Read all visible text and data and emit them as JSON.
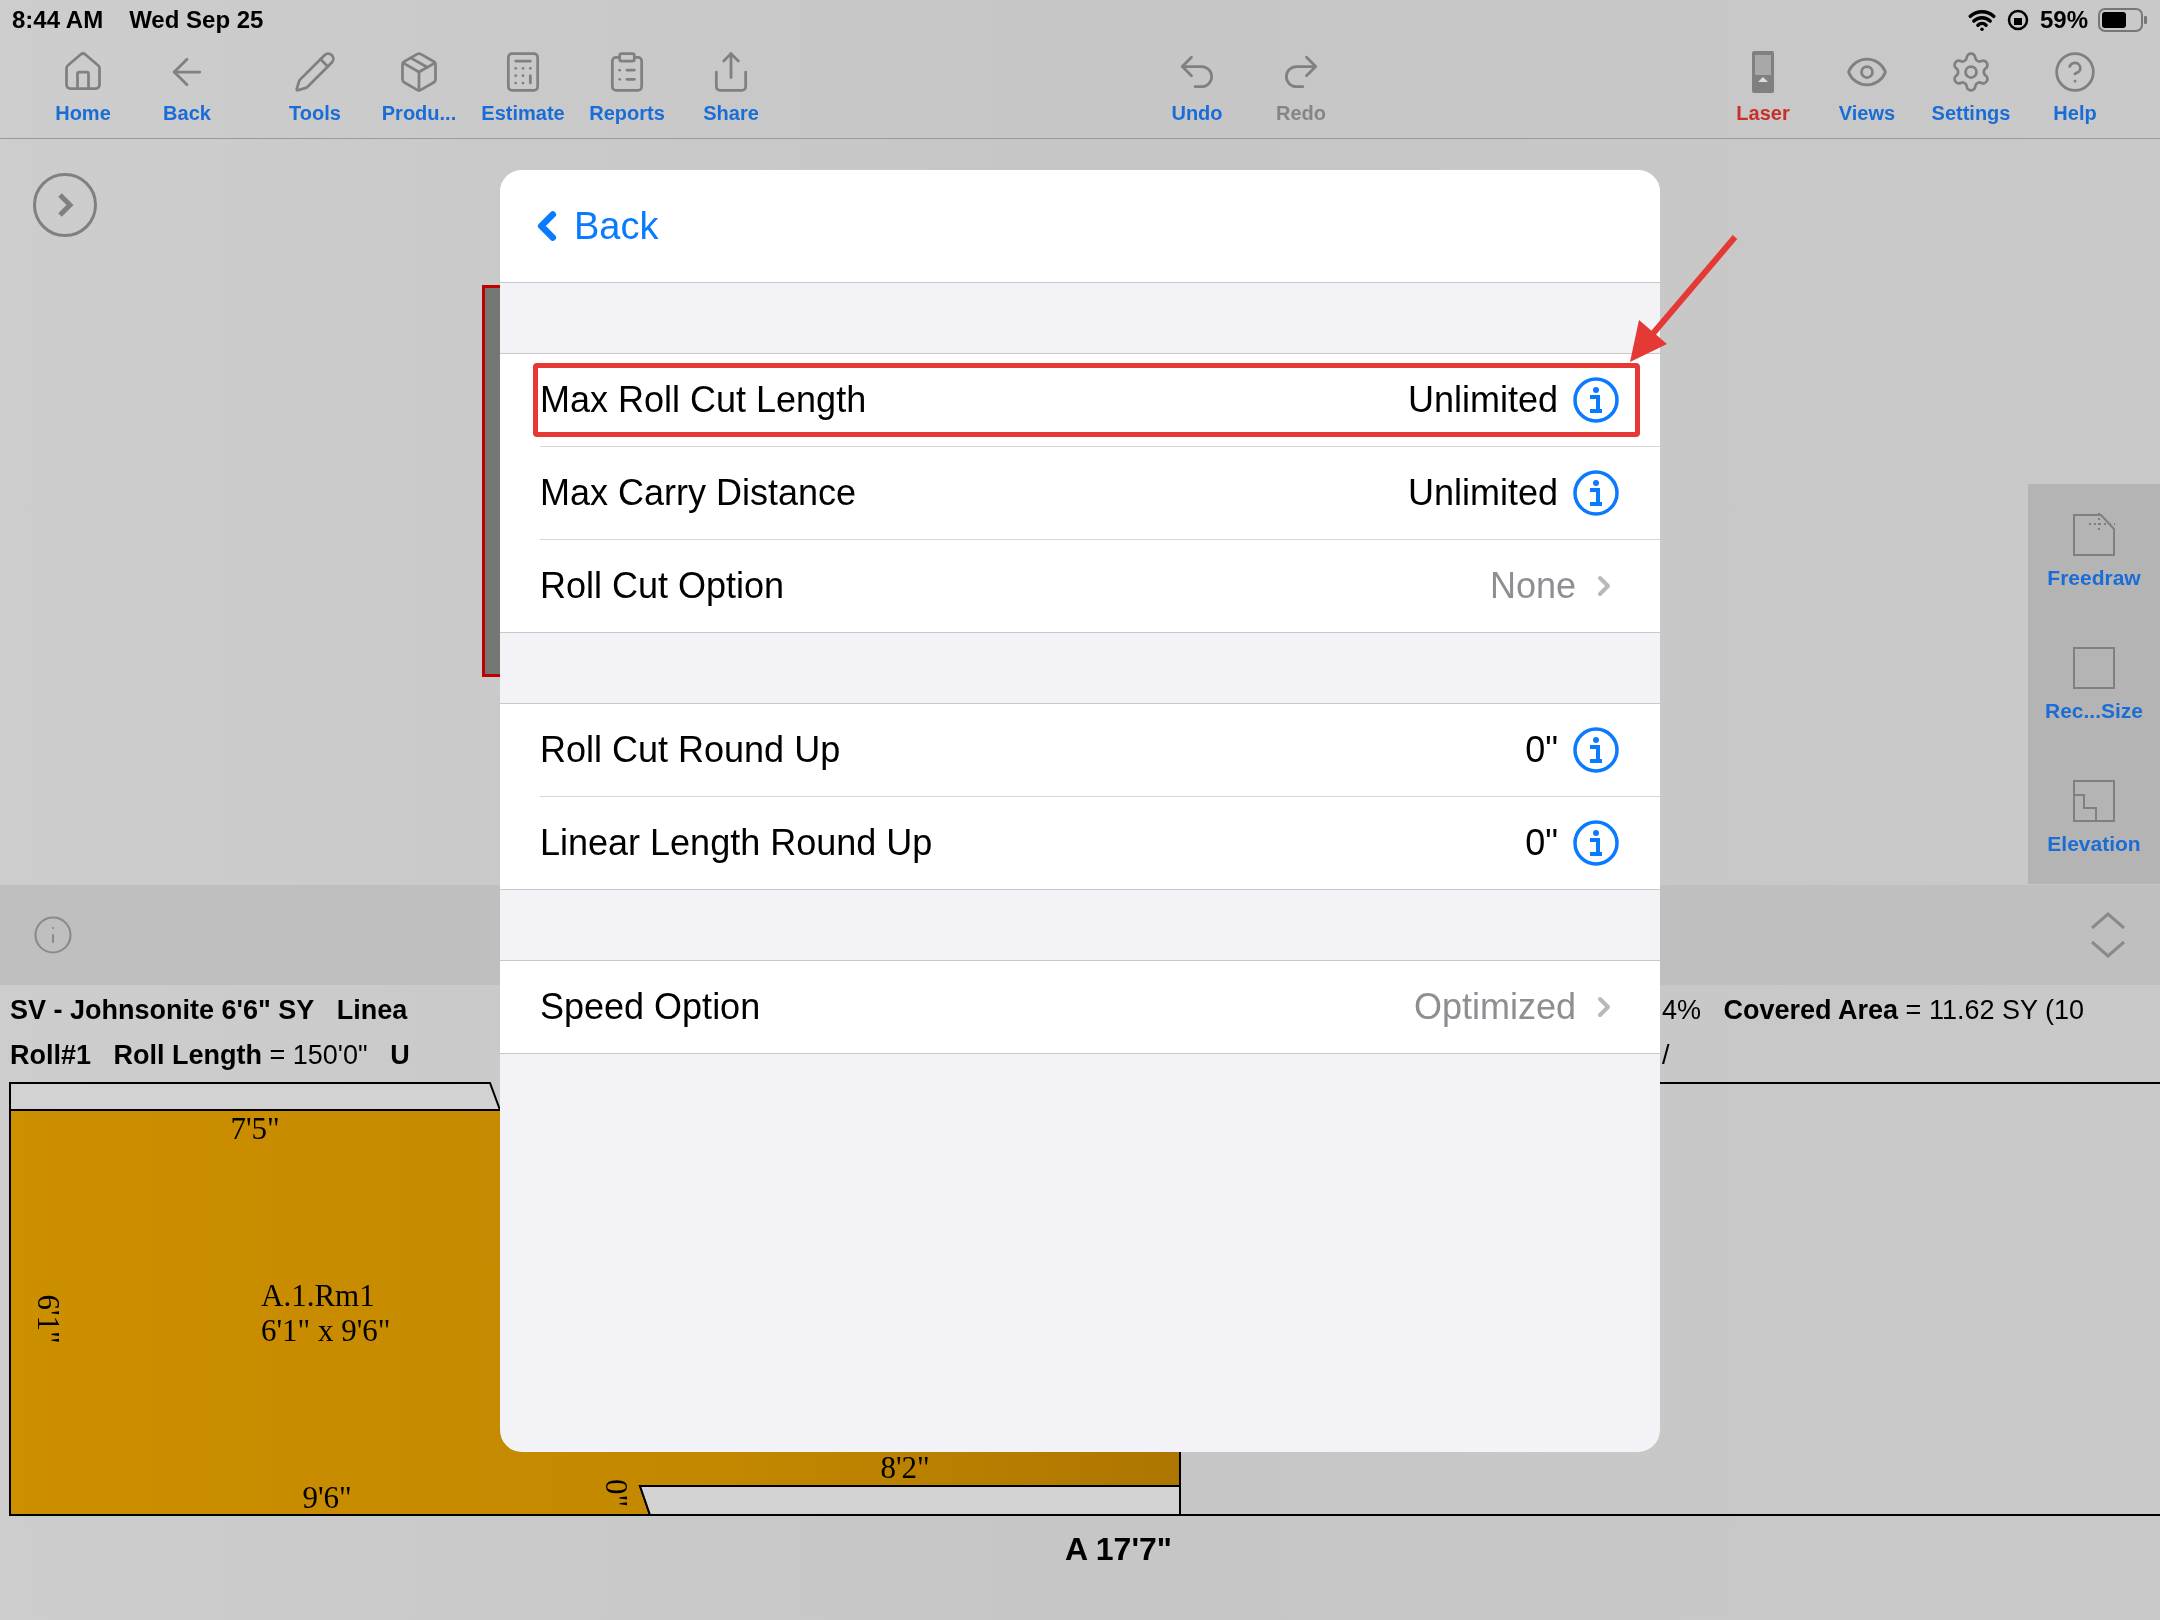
{
  "status_bar": {
    "time": "8:44 AM",
    "date": "Wed Sep 25",
    "battery_text": "59%"
  },
  "toolbar": {
    "left": [
      {
        "label": "Home",
        "color": "#1a6dd6"
      },
      {
        "label": "Back",
        "color": "#1a6dd6"
      },
      {
        "label": "Tools",
        "color": "#1a6dd6"
      },
      {
        "label": "Produ...",
        "color": "#1a6dd6"
      },
      {
        "label": "Estimate",
        "color": "#1a6dd6"
      },
      {
        "label": "Reports",
        "color": "#1a6dd6"
      },
      {
        "label": "Share",
        "color": "#1a6dd6"
      }
    ],
    "center": [
      {
        "label": "Undo",
        "color": "#1a6dd6"
      },
      {
        "label": "Redo",
        "color": "#858585"
      }
    ],
    "right": [
      {
        "label": "Laser",
        "color": "#c9302a"
      },
      {
        "label": "Views",
        "color": "#1a6dd6"
      },
      {
        "label": "Settings",
        "color": "#1a6dd6"
      },
      {
        "label": "Help",
        "color": "#1a6dd6"
      }
    ]
  },
  "side_panel": {
    "items": [
      {
        "label": "Freedraw"
      },
      {
        "label": "Rec...Size"
      },
      {
        "label": "Elevation"
      }
    ]
  },
  "summary": {
    "lines": [
      {
        "left": "**SV - Johnsonite 6'6\" SY**   **Linea**",
        "right": "4%   **Covered Area** = 11.62 SY (10"
      },
      {
        "left": "**Roll#1**   **Roll Length** = 150'0\"   **U**",
        "right": "/"
      }
    ]
  },
  "drawing": {
    "top_width": "7'5\"",
    "name": "A.1.Rm1",
    "size": "6'1\" x 9'6\"",
    "left_height": "6'1\"",
    "bottom_width": "9'6\"",
    "strip_width": "8'2\"",
    "edge": "0\""
  },
  "footer_label": "A 17'7\"",
  "modal": {
    "back_label": "Back",
    "sections": [
      [
        {
          "kind": "info",
          "label": "Max Roll Cut Length",
          "value": "Unlimited",
          "highlighted": true
        },
        {
          "kind": "info",
          "label": "Max Carry Distance",
          "value": "Unlimited",
          "highlighted": false
        },
        {
          "kind": "disclosure",
          "label": "Roll Cut Option",
          "value": "None",
          "highlighted": false
        }
      ],
      [
        {
          "kind": "info",
          "label": "Roll Cut Round Up",
          "value": "0\"",
          "highlighted": false
        },
        {
          "kind": "info",
          "label": "Linear Length Round Up",
          "value": "0\"",
          "highlighted": false
        }
      ],
      [
        {
          "kind": "disclosure",
          "label": "Speed Option",
          "value": "Optimized",
          "highlighted": false
        }
      ]
    ]
  }
}
